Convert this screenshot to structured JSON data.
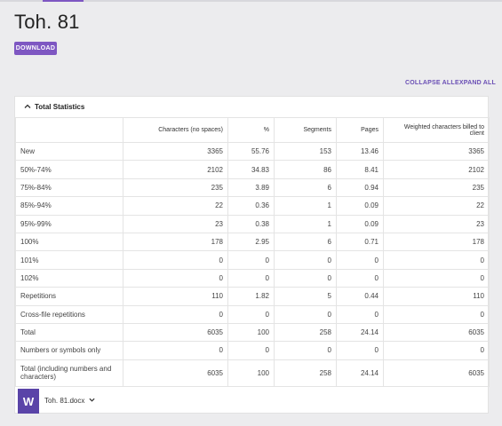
{
  "header": {
    "title": "Toh. 81",
    "download_label": "DOWNLOAD"
  },
  "actions": {
    "collapse_all": "COLLAPSE ALL",
    "expand_all": "EXPAND ALL"
  },
  "section": {
    "title": "Total Statistics"
  },
  "table": {
    "columns": [
      "",
      "Characters (no spaces)",
      "%",
      "Segments",
      "Pages",
      "Weighted characters billed to client"
    ],
    "rows": [
      [
        "New",
        "3365",
        "55.76",
        "153",
        "13.46",
        "3365"
      ],
      [
        "50%-74%",
        "2102",
        "34.83",
        "86",
        "8.41",
        "2102"
      ],
      [
        "75%-84%",
        "235",
        "3.89",
        "6",
        "0.94",
        "235"
      ],
      [
        "85%-94%",
        "22",
        "0.36",
        "1",
        "0.09",
        "22"
      ],
      [
        "95%-99%",
        "23",
        "0.38",
        "1",
        "0.09",
        "23"
      ],
      [
        "100%",
        "178",
        "2.95",
        "6",
        "0.71",
        "178"
      ],
      [
        "101%",
        "0",
        "0",
        "0",
        "0",
        "0"
      ],
      [
        "102%",
        "0",
        "0",
        "0",
        "0",
        "0"
      ],
      [
        "Repetitions",
        "110",
        "1.82",
        "5",
        "0.44",
        "110"
      ],
      [
        "Cross-file repetitions",
        "0",
        "0",
        "0",
        "0",
        "0"
      ],
      [
        "Total",
        "6035",
        "100",
        "258",
        "24.14",
        "6035"
      ],
      [
        "Numbers or symbols only",
        "0",
        "0",
        "0",
        "0",
        "0"
      ],
      [
        "Total (including numbers and characters)",
        "6035",
        "100",
        "258",
        "24.14",
        "6035"
      ]
    ]
  },
  "file": {
    "icon_letter": "W",
    "name": "Toh. 81.docx",
    "icon": "word-file-icon"
  },
  "colors": {
    "accent": "#7e57c2",
    "file_icon": "#5a44a8",
    "background": "#ececee"
  }
}
